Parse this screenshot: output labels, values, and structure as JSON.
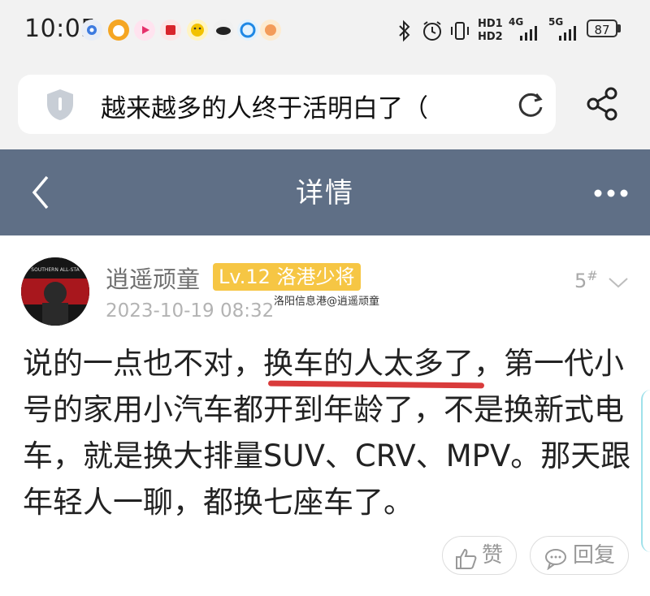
{
  "status_bar": {
    "time": "10:05",
    "battery": "87",
    "signal_labels": [
      "HD1",
      "HD2",
      "4G",
      "5G"
    ],
    "notification_icons": [
      "settings-app-icon",
      "bun-app-icon",
      "video-app-icon",
      "news-app-icon",
      "emoji-app-icon",
      "cloud-app-icon",
      "map-app-icon",
      "gallery-app-icon"
    ]
  },
  "browser": {
    "url_text": "越来越多的人终于活明白了（",
    "icons": [
      "shield-icon",
      "refresh-icon",
      "share-icon"
    ]
  },
  "header": {
    "title": "详情",
    "back_icon": "chevron-left-icon",
    "more_icon": "more-dots-icon"
  },
  "post": {
    "username": "逍遥顽童",
    "level": "Lv.12 洛港少将",
    "floor_number": "5",
    "floor_mark": "#",
    "watermark": "洛阳信息港@逍遥顽童",
    "timestamp": "2023-10-19 08:32",
    "avatar_text": "SOUTHERN ALL-STA",
    "body_before": "说的一点也不对，",
    "body_highlight": "换车的人太多了",
    "body_after": "，第一代小号的家用小汽车都开到年龄了，不是换新式电车，就是换大排量SUV、CRV、MPV。那天跟年轻人一聊，都换七座车了。",
    "like_label": "赞",
    "reply_label": "回复"
  },
  "colors": {
    "header_bg": "#5f6f86",
    "level_badge": "#f6c644",
    "underline": "#d93b3b"
  }
}
